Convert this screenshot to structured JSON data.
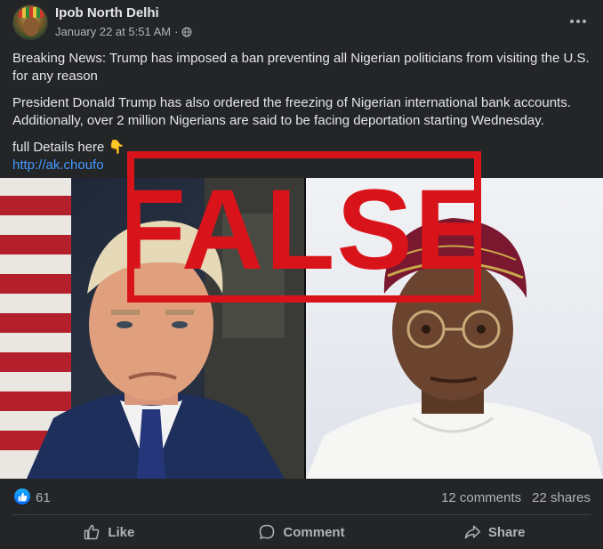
{
  "post": {
    "author": "Ipob North Delhi",
    "timestamp": "January 22 at 5:51 AM",
    "visibility_icon": "globe-icon",
    "more_icon": "more-options-icon",
    "paragraphs": [
      "Breaking News: Trump has imposed a ban preventing all Nigerian politicians from visiting the U.S. for any reason",
      "President Donald Trump has also ordered the freezing of Nigerian international bank accounts. Additionally, over 2 million Nigerians are said to be facing deportation starting Wednesday.",
      "full Details here 👇"
    ],
    "link_text": "http://ak.choufo"
  },
  "media": {
    "stamp_text": "FALSE",
    "stamp_color": "#d8141a"
  },
  "reactions": {
    "like_icon": "thumbs-up-icon",
    "like_count": "61",
    "comments": "12 comments",
    "shares": "22 shares"
  },
  "actions": {
    "like": "Like",
    "comment": "Comment",
    "share": "Share"
  },
  "colors": {
    "background": "#242526",
    "text": "#e4e6eb",
    "secondary_text": "#b0b3b8",
    "link": "#4599ff",
    "accent": "#0866ff"
  }
}
